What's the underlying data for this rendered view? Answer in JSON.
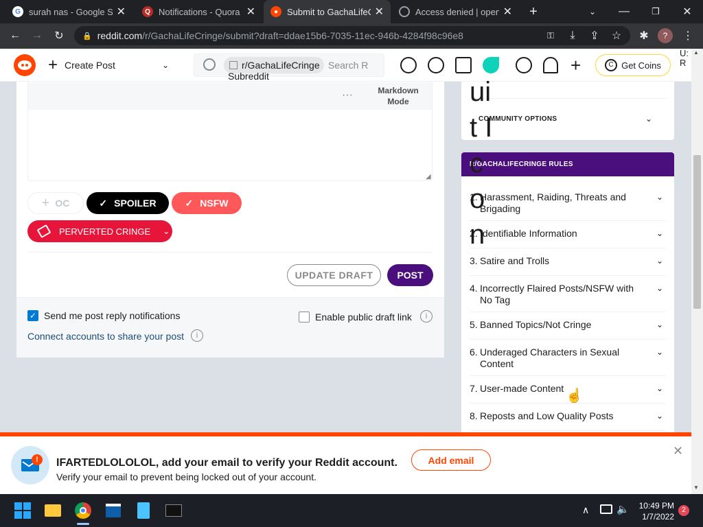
{
  "browser": {
    "tabs": [
      {
        "title": "surah nas - Google Search",
        "icon": "google-icon"
      },
      {
        "title": "Notifications - Quora",
        "icon": "quora-icon"
      },
      {
        "title": "Submit to GachaLifeCringe",
        "icon": "reddit-icon"
      },
      {
        "title": "Access denied | opensea",
        "icon": "globe-icon"
      }
    ],
    "url_host": "reddit.com",
    "url_path": "/r/GachaLifeCringe/submit?draft=ddae15b6-7035-11ec-946b-4284f98c96e8",
    "profile_initial": "?"
  },
  "header": {
    "create_post": "Create Post",
    "subreddit_chip": "r/GachaLifeCringe",
    "subreddit_icon_alt": "Subreddit Icon",
    "search_placeholder": "Search R",
    "get_coins": "Get Coins",
    "right_edge_text": "U: R"
  },
  "editor": {
    "markdown_mode": "Markdown Mode"
  },
  "tags": {
    "oc": "OC",
    "spoiler": "SPOILER",
    "nsfw": "NSFW",
    "flair": "PERVERTED CRINGE"
  },
  "actions": {
    "update_draft": "UPDATE DRAFT",
    "post": "POST"
  },
  "footer": {
    "send_notifications": "Send me post reply notifications",
    "send_notifications_checked": true,
    "public_draft": "Enable public draft link",
    "public_draft_checked": false,
    "connect_accounts": "Connect accounts to share your post"
  },
  "sidebar": {
    "overflow_text": "ui t Ic o n",
    "community_options": "COMMUNITY OPTIONS",
    "rules_title": "R/GACHALIFECRINGE RULES",
    "rules": [
      {
        "num": "1.",
        "text": "Harassment, Raiding, Threats and Brigading"
      },
      {
        "num": "2.",
        "text": "Identifiable Information"
      },
      {
        "num": "3.",
        "text": "Satire and Trolls"
      },
      {
        "num": "4.",
        "text": "Incorrectly Flaired Posts/NSFW with No Tag"
      },
      {
        "num": "5.",
        "text": "Banned Topics/Not Cringe"
      },
      {
        "num": "6.",
        "text": "Underaged Characters in Sexual Content"
      },
      {
        "num": "7.",
        "text": "User-made Content"
      },
      {
        "num": "8.",
        "text": "Reposts and Low Quality Posts"
      }
    ]
  },
  "banner": {
    "title": "IFARTEDLOLOLOL, add your email to verify your Reddit account.",
    "subtitle": "Verify your email to prevent being locked out of your account.",
    "add_email": "Add email",
    "badge": "!"
  },
  "taskbar": {
    "time": "10:49 PM",
    "date": "1/7/2022",
    "notification_count": "2"
  },
  "colors": {
    "reddit_orange": "#ff4500",
    "community_purple": "#4b0f7d",
    "nsfw_red": "#ff585b",
    "flair_red": "#e8153a",
    "checkbox_blue": "#0079d3"
  }
}
